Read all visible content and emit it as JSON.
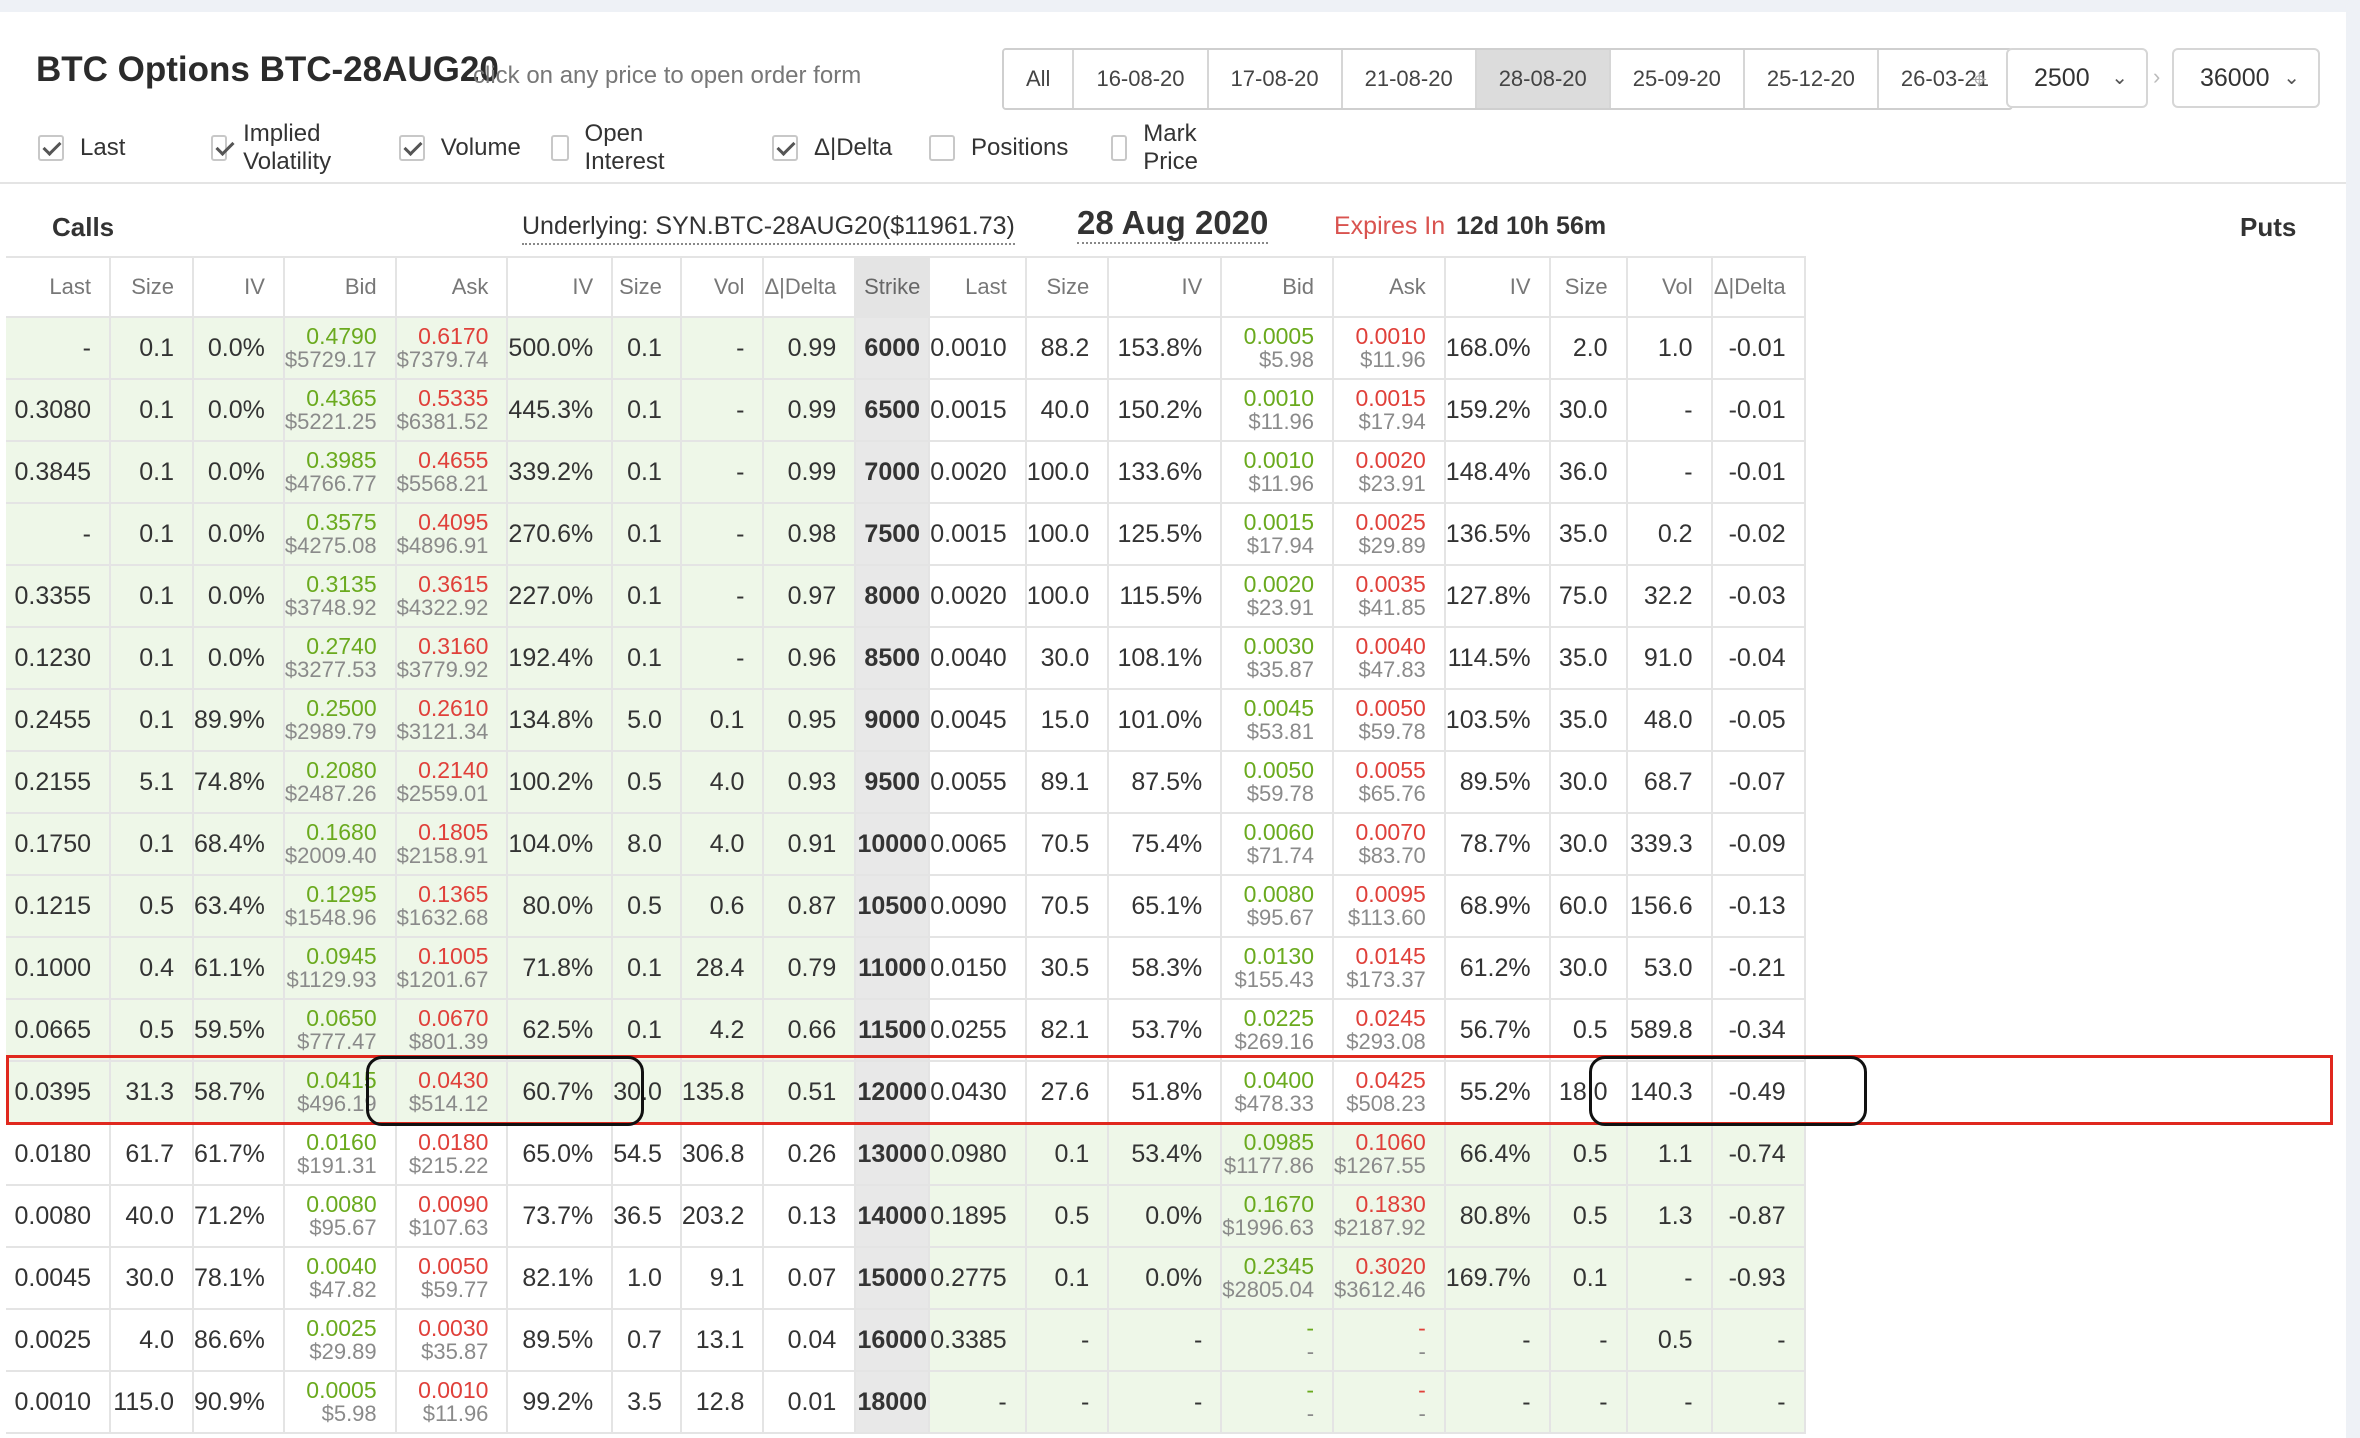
{
  "header": {
    "title": "BTC Options BTC-28AUG20",
    "hint": "click on any price to open order form",
    "date_tabs": [
      {
        "label": "All",
        "active": false
      },
      {
        "label": "16-08-20",
        "active": false
      },
      {
        "label": "17-08-20",
        "active": false
      },
      {
        "label": "21-08-20",
        "active": false
      },
      {
        "label": "28-08-20",
        "active": true
      },
      {
        "label": "25-09-20",
        "active": false
      },
      {
        "label": "25-12-20",
        "active": false
      },
      {
        "label": "26-03-21",
        "active": false
      }
    ],
    "strike_min": "2500",
    "strike_max": "36000"
  },
  "filters": [
    {
      "label": "Last",
      "checked": true
    },
    {
      "label": "Implied Volatility",
      "checked": true
    },
    {
      "label": "Volume",
      "checked": true
    },
    {
      "label": "Open Interest",
      "checked": false
    },
    {
      "label": "Δ|Delta",
      "checked": true
    },
    {
      "label": "Positions",
      "checked": false
    },
    {
      "label": "Mark Price",
      "checked": false
    }
  ],
  "info": {
    "calls_label": "Calls",
    "puts_label": "Puts",
    "underlying": "Underlying: SYN.BTC-28AUG20($11961.73)",
    "expiry_date": "28 Aug 2020",
    "expires_in_label": "Expires In",
    "expires_in_value": "12d 10h 56m"
  },
  "columns": [
    "Last",
    "Size",
    "IV",
    "Bid",
    "Ask",
    "IV",
    "Size",
    "Vol",
    "Δ|Delta",
    "Strike",
    "Last",
    "Size",
    "IV",
    "Bid",
    "Ask",
    "IV",
    "Size",
    "Vol",
    "Δ|Delta"
  ],
  "rows": [
    {
      "strike": "6000",
      "call": {
        "last": "-",
        "bsize": "0.1",
        "biv": "0.0%",
        "bid": "0.4790",
        "bid_usd": "$5729.17",
        "ask": "0.6170",
        "ask_usd": "$7379.74",
        "aiv": "500.0%",
        "asize": "0.1",
        "vol": "-",
        "delta": "0.99"
      },
      "put": {
        "last": "0.0010",
        "bsize": "88.2",
        "biv": "153.8%",
        "bid": "0.0005",
        "bid_usd": "$5.98",
        "ask": "0.0010",
        "ask_usd": "$11.96",
        "aiv": "168.0%",
        "asize": "2.0",
        "vol": "1.0",
        "delta": "-0.01"
      }
    },
    {
      "strike": "6500",
      "call": {
        "last": "0.3080",
        "bsize": "0.1",
        "biv": "0.0%",
        "bid": "0.4365",
        "bid_usd": "$5221.25",
        "ask": "0.5335",
        "ask_usd": "$6381.52",
        "aiv": "445.3%",
        "asize": "0.1",
        "vol": "-",
        "delta": "0.99"
      },
      "put": {
        "last": "0.0015",
        "bsize": "40.0",
        "biv": "150.2%",
        "bid": "0.0010",
        "bid_usd": "$11.96",
        "ask": "0.0015",
        "ask_usd": "$17.94",
        "aiv": "159.2%",
        "asize": "30.0",
        "vol": "-",
        "delta": "-0.01"
      }
    },
    {
      "strike": "7000",
      "call": {
        "last": "0.3845",
        "bsize": "0.1",
        "biv": "0.0%",
        "bid": "0.3985",
        "bid_usd": "$4766.77",
        "ask": "0.4655",
        "ask_usd": "$5568.21",
        "aiv": "339.2%",
        "asize": "0.1",
        "vol": "-",
        "delta": "0.99"
      },
      "put": {
        "last": "0.0020",
        "bsize": "100.0",
        "biv": "133.6%",
        "bid": "0.0010",
        "bid_usd": "$11.96",
        "ask": "0.0020",
        "ask_usd": "$23.91",
        "aiv": "148.4%",
        "asize": "36.0",
        "vol": "-",
        "delta": "-0.01"
      }
    },
    {
      "strike": "7500",
      "call": {
        "last": "-",
        "bsize": "0.1",
        "biv": "0.0%",
        "bid": "0.3575",
        "bid_usd": "$4275.08",
        "ask": "0.4095",
        "ask_usd": "$4896.91",
        "aiv": "270.6%",
        "asize": "0.1",
        "vol": "-",
        "delta": "0.98"
      },
      "put": {
        "last": "0.0015",
        "bsize": "100.0",
        "biv": "125.5%",
        "bid": "0.0015",
        "bid_usd": "$17.94",
        "ask": "0.0025",
        "ask_usd": "$29.89",
        "aiv": "136.5%",
        "asize": "35.0",
        "vol": "0.2",
        "delta": "-0.02"
      }
    },
    {
      "strike": "8000",
      "call": {
        "last": "0.3355",
        "bsize": "0.1",
        "biv": "0.0%",
        "bid": "0.3135",
        "bid_usd": "$3748.92",
        "ask": "0.3615",
        "ask_usd": "$4322.92",
        "aiv": "227.0%",
        "asize": "0.1",
        "vol": "-",
        "delta": "0.97"
      },
      "put": {
        "last": "0.0020",
        "bsize": "100.0",
        "biv": "115.5%",
        "bid": "0.0020",
        "bid_usd": "$23.91",
        "ask": "0.0035",
        "ask_usd": "$41.85",
        "aiv": "127.8%",
        "asize": "75.0",
        "vol": "32.2",
        "delta": "-0.03"
      }
    },
    {
      "strike": "8500",
      "call": {
        "last": "0.1230",
        "bsize": "0.1",
        "biv": "0.0%",
        "bid": "0.2740",
        "bid_usd": "$3277.53",
        "ask": "0.3160",
        "ask_usd": "$3779.92",
        "aiv": "192.4%",
        "asize": "0.1",
        "vol": "-",
        "delta": "0.96"
      },
      "put": {
        "last": "0.0040",
        "bsize": "30.0",
        "biv": "108.1%",
        "bid": "0.0030",
        "bid_usd": "$35.87",
        "ask": "0.0040",
        "ask_usd": "$47.83",
        "aiv": "114.5%",
        "asize": "35.0",
        "vol": "91.0",
        "delta": "-0.04"
      }
    },
    {
      "strike": "9000",
      "call": {
        "last": "0.2455",
        "bsize": "0.1",
        "biv": "89.9%",
        "bid": "0.2500",
        "bid_usd": "$2989.79",
        "ask": "0.2610",
        "ask_usd": "$3121.34",
        "aiv": "134.8%",
        "asize": "5.0",
        "vol": "0.1",
        "delta": "0.95"
      },
      "put": {
        "last": "0.0045",
        "bsize": "15.0",
        "biv": "101.0%",
        "bid": "0.0045",
        "bid_usd": "$53.81",
        "ask": "0.0050",
        "ask_usd": "$59.78",
        "aiv": "103.5%",
        "asize": "35.0",
        "vol": "48.0",
        "delta": "-0.05"
      }
    },
    {
      "strike": "9500",
      "call": {
        "last": "0.2155",
        "bsize": "5.1",
        "biv": "74.8%",
        "bid": "0.2080",
        "bid_usd": "$2487.26",
        "ask": "0.2140",
        "ask_usd": "$2559.01",
        "aiv": "100.2%",
        "asize": "0.5",
        "vol": "4.0",
        "delta": "0.93"
      },
      "put": {
        "last": "0.0055",
        "bsize": "89.1",
        "biv": "87.5%",
        "bid": "0.0050",
        "bid_usd": "$59.78",
        "ask": "0.0055",
        "ask_usd": "$65.76",
        "aiv": "89.5%",
        "asize": "30.0",
        "vol": "68.7",
        "delta": "-0.07"
      }
    },
    {
      "strike": "10000",
      "call": {
        "last": "0.1750",
        "bsize": "0.1",
        "biv": "68.4%",
        "bid": "0.1680",
        "bid_usd": "$2009.40",
        "ask": "0.1805",
        "ask_usd": "$2158.91",
        "aiv": "104.0%",
        "asize": "8.0",
        "vol": "4.0",
        "delta": "0.91"
      },
      "put": {
        "last": "0.0065",
        "bsize": "70.5",
        "biv": "75.4%",
        "bid": "0.0060",
        "bid_usd": "$71.74",
        "ask": "0.0070",
        "ask_usd": "$83.70",
        "aiv": "78.7%",
        "asize": "30.0",
        "vol": "339.3",
        "delta": "-0.09"
      }
    },
    {
      "strike": "10500",
      "call": {
        "last": "0.1215",
        "bsize": "0.5",
        "biv": "63.4%",
        "bid": "0.1295",
        "bid_usd": "$1548.96",
        "ask": "0.1365",
        "ask_usd": "$1632.68",
        "aiv": "80.0%",
        "asize": "0.5",
        "vol": "0.6",
        "delta": "0.87"
      },
      "put": {
        "last": "0.0090",
        "bsize": "70.5",
        "biv": "65.1%",
        "bid": "0.0080",
        "bid_usd": "$95.67",
        "ask": "0.0095",
        "ask_usd": "$113.60",
        "aiv": "68.9%",
        "asize": "60.0",
        "vol": "156.6",
        "delta": "-0.13"
      }
    },
    {
      "strike": "11000",
      "call": {
        "last": "0.1000",
        "bsize": "0.4",
        "biv": "61.1%",
        "bid": "0.0945",
        "bid_usd": "$1129.93",
        "ask": "0.1005",
        "ask_usd": "$1201.67",
        "aiv": "71.8%",
        "asize": "0.1",
        "vol": "28.4",
        "delta": "0.79"
      },
      "put": {
        "last": "0.0150",
        "bsize": "30.5",
        "biv": "58.3%",
        "bid": "0.0130",
        "bid_usd": "$155.43",
        "ask": "0.0145",
        "ask_usd": "$173.37",
        "aiv": "61.2%",
        "asize": "30.0",
        "vol": "53.0",
        "delta": "-0.21"
      }
    },
    {
      "strike": "11500",
      "call": {
        "last": "0.0665",
        "bsize": "0.5",
        "biv": "59.5%",
        "bid": "0.0650",
        "bid_usd": "$777.47",
        "ask": "0.0670",
        "ask_usd": "$801.39",
        "aiv": "62.5%",
        "asize": "0.1",
        "vol": "4.2",
        "delta": "0.66"
      },
      "put": {
        "last": "0.0255",
        "bsize": "82.1",
        "biv": "53.7%",
        "bid": "0.0225",
        "bid_usd": "$269.16",
        "ask": "0.0245",
        "ask_usd": "$293.08",
        "aiv": "56.7%",
        "asize": "0.5",
        "vol": "589.8",
        "delta": "-0.34"
      }
    },
    {
      "strike": "12000",
      "call": {
        "last": "0.0395",
        "bsize": "31.3",
        "biv": "58.7%",
        "bid": "0.0415",
        "bid_usd": "$496.19",
        "ask": "0.0430",
        "ask_usd": "$514.12",
        "aiv": "60.7%",
        "asize": "30.0",
        "vol": "135.8",
        "delta": "0.51"
      },
      "put": {
        "last": "0.0430",
        "bsize": "27.6",
        "biv": "51.8%",
        "bid": "0.0400",
        "bid_usd": "$478.33",
        "ask": "0.0425",
        "ask_usd": "$508.23",
        "aiv": "55.2%",
        "asize": "18.0",
        "vol": "140.3",
        "delta": "-0.49"
      }
    },
    {
      "strike": "13000",
      "call": {
        "last": "0.0180",
        "bsize": "61.7",
        "biv": "61.7%",
        "bid": "0.0160",
        "bid_usd": "$191.31",
        "ask": "0.0180",
        "ask_usd": "$215.22",
        "aiv": "65.0%",
        "asize": "54.5",
        "vol": "306.8",
        "delta": "0.26"
      },
      "put": {
        "last": "0.0980",
        "bsize": "0.1",
        "biv": "53.4%",
        "bid": "0.0985",
        "bid_usd": "$1177.86",
        "ask": "0.1060",
        "ask_usd": "$1267.55",
        "aiv": "66.4%",
        "asize": "0.5",
        "vol": "1.1",
        "delta": "-0.74"
      }
    },
    {
      "strike": "14000",
      "call": {
        "last": "0.0080",
        "bsize": "40.0",
        "biv": "71.2%",
        "bid": "0.0080",
        "bid_usd": "$95.67",
        "ask": "0.0090",
        "ask_usd": "$107.63",
        "aiv": "73.7%",
        "asize": "36.5",
        "vol": "203.2",
        "delta": "0.13"
      },
      "put": {
        "last": "0.1895",
        "bsize": "0.5",
        "biv": "0.0%",
        "bid": "0.1670",
        "bid_usd": "$1996.63",
        "ask": "0.1830",
        "ask_usd": "$2187.92",
        "aiv": "80.8%",
        "asize": "0.5",
        "vol": "1.3",
        "delta": "-0.87"
      }
    },
    {
      "strike": "15000",
      "call": {
        "last": "0.0045",
        "bsize": "30.0",
        "biv": "78.1%",
        "bid": "0.0040",
        "bid_usd": "$47.82",
        "ask": "0.0050",
        "ask_usd": "$59.77",
        "aiv": "82.1%",
        "asize": "1.0",
        "vol": "9.1",
        "delta": "0.07"
      },
      "put": {
        "last": "0.2775",
        "bsize": "0.1",
        "biv": "0.0%",
        "bid": "0.2345",
        "bid_usd": "$2805.04",
        "ask": "0.3020",
        "ask_usd": "$3612.46",
        "aiv": "169.7%",
        "asize": "0.1",
        "vol": "-",
        "delta": "-0.93"
      }
    },
    {
      "strike": "16000",
      "call": {
        "last": "0.0025",
        "bsize": "4.0",
        "biv": "86.6%",
        "bid": "0.0025",
        "bid_usd": "$29.89",
        "ask": "0.0030",
        "ask_usd": "$35.87",
        "aiv": "89.5%",
        "asize": "0.7",
        "vol": "13.1",
        "delta": "0.04"
      },
      "put": {
        "last": "0.3385",
        "bsize": "-",
        "biv": "-",
        "bid": "-",
        "bid_usd": "-",
        "ask": "-",
        "ask_usd": "-",
        "aiv": "-",
        "asize": "-",
        "vol": "0.5",
        "delta": "-"
      }
    },
    {
      "strike": "18000",
      "call": {
        "last": "0.0010",
        "bsize": "115.0",
        "biv": "90.9%",
        "bid": "0.0005",
        "bid_usd": "$5.98",
        "ask": "0.0010",
        "ask_usd": "$11.96",
        "aiv": "99.2%",
        "asize": "3.5",
        "vol": "12.8",
        "delta": "0.01"
      },
      "put": {
        "last": "-",
        "bsize": "-",
        "biv": "-",
        "bid": "-",
        "bid_usd": "-",
        "ask": "-",
        "ask_usd": "-",
        "aiv": "-",
        "asize": "-",
        "vol": "-",
        "delta": "-"
      }
    }
  ]
}
